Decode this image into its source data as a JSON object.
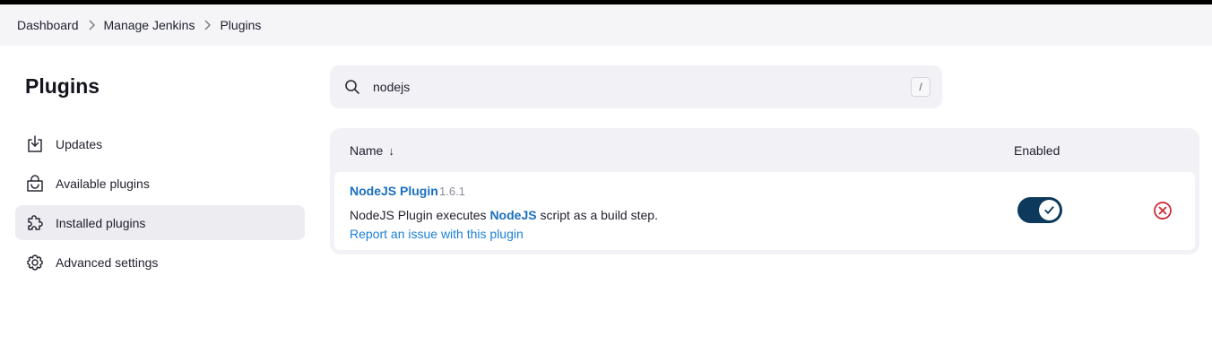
{
  "breadcrumb": {
    "items": [
      {
        "label": "Dashboard"
      },
      {
        "label": "Manage Jenkins"
      },
      {
        "label": "Plugins"
      }
    ]
  },
  "page": {
    "title": "Plugins"
  },
  "sidebar": {
    "items": [
      {
        "label": "Updates",
        "icon": "download-icon",
        "active": false
      },
      {
        "label": "Available plugins",
        "icon": "shopping-bag-icon",
        "active": false
      },
      {
        "label": "Installed plugins",
        "icon": "puzzle-piece-icon",
        "active": true
      },
      {
        "label": "Advanced settings",
        "icon": "gear-icon",
        "active": false
      }
    ]
  },
  "search": {
    "value": "nodejs",
    "shortcut": "/"
  },
  "table": {
    "columns": {
      "name": "Name",
      "sort_indicator": "↓",
      "enabled": "Enabled"
    },
    "rows": [
      {
        "name": "NodeJS Plugin",
        "version": "1.6.1",
        "description_prefix": "NodeJS Plugin executes ",
        "description_link": "NodeJS",
        "description_suffix": " script as a build step.",
        "report_link": "Report an issue with this plugin",
        "enabled": true
      }
    ]
  },
  "colors": {
    "accent_link": "#1a6fc0",
    "toggle_on": "#0d3a5c",
    "uninstall_red": "#d0222e",
    "active_nav_bg": "#ececf1"
  }
}
